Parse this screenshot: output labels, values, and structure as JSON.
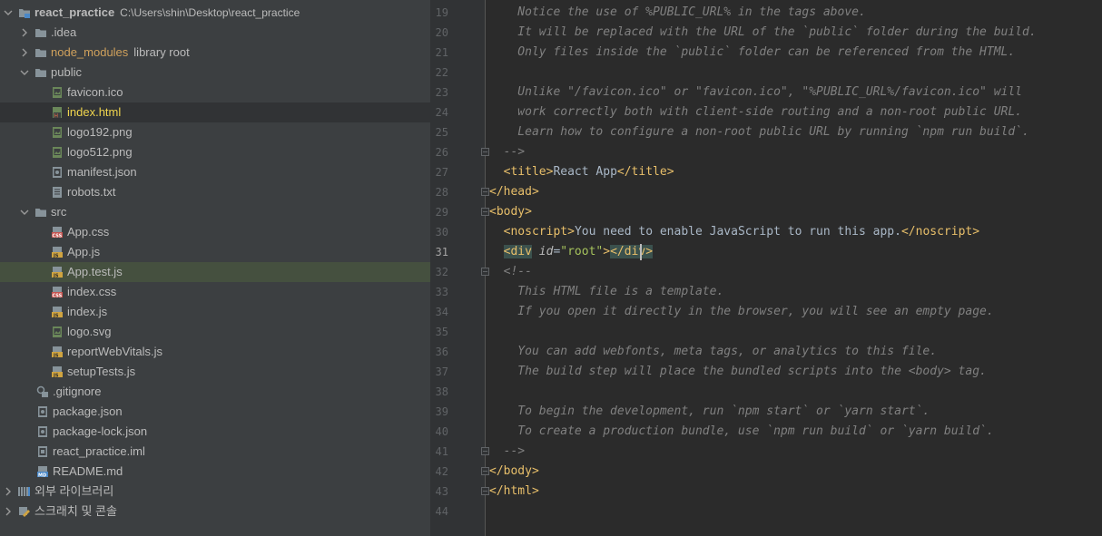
{
  "tree": {
    "root": {
      "name": "react_practice",
      "path": "C:\\Users\\shin\\Desktop\\react_practice"
    },
    "items": [
      {
        "label": ".idea",
        "sub": "",
        "type": "folder",
        "indent": 1,
        "expand": "closed"
      },
      {
        "label": "node_modules",
        "sub": "library root",
        "type": "folder",
        "indent": 1,
        "expand": "closed",
        "color": "#d0a15c"
      },
      {
        "label": "public",
        "sub": "",
        "type": "folder",
        "indent": 1,
        "expand": "open"
      },
      {
        "label": "favicon.ico",
        "sub": "",
        "type": "image",
        "indent": 2
      },
      {
        "label": "index.html",
        "sub": "",
        "type": "html",
        "indent": 2,
        "color": "#f0d54e",
        "selected": true
      },
      {
        "label": "logo192.png",
        "sub": "",
        "type": "image",
        "indent": 2
      },
      {
        "label": "logo512.png",
        "sub": "",
        "type": "image",
        "indent": 2
      },
      {
        "label": "manifest.json",
        "sub": "",
        "type": "json",
        "indent": 2
      },
      {
        "label": "robots.txt",
        "sub": "",
        "type": "text",
        "indent": 2
      },
      {
        "label": "src",
        "sub": "",
        "type": "folder",
        "indent": 1,
        "expand": "open"
      },
      {
        "label": "App.css",
        "sub": "",
        "type": "css",
        "indent": 2
      },
      {
        "label": "App.js",
        "sub": "",
        "type": "js",
        "indent": 2
      },
      {
        "label": "App.test.js",
        "sub": "",
        "type": "js",
        "indent": 2,
        "highlight": true
      },
      {
        "label": "index.css",
        "sub": "",
        "type": "css",
        "indent": 2
      },
      {
        "label": "index.js",
        "sub": "",
        "type": "js",
        "indent": 2
      },
      {
        "label": "logo.svg",
        "sub": "",
        "type": "image",
        "indent": 2
      },
      {
        "label": "reportWebVitals.js",
        "sub": "",
        "type": "js",
        "indent": 2
      },
      {
        "label": "setupTests.js",
        "sub": "",
        "type": "js",
        "indent": 2
      },
      {
        "label": ".gitignore",
        "sub": "",
        "type": "git",
        "indent": 1
      },
      {
        "label": "package.json",
        "sub": "",
        "type": "json",
        "indent": 1
      },
      {
        "label": "package-lock.json",
        "sub": "",
        "type": "json",
        "indent": 1
      },
      {
        "label": "react_practice.iml",
        "sub": "",
        "type": "iml",
        "indent": 1
      },
      {
        "label": "README.md",
        "sub": "",
        "type": "md",
        "indent": 1
      },
      {
        "label": "외부 라이브러리",
        "sub": "",
        "type": "library",
        "indent": 0,
        "expand": "closed"
      },
      {
        "label": "스크래치 및 콘솔",
        "sub": "",
        "type": "scratch",
        "indent": 0,
        "expand": "closed"
      }
    ]
  },
  "editor": {
    "current_line": 31,
    "lines": [
      {
        "n": "19",
        "html": "<span class='comment'>    Notice the use of %PUBLIC_URL% in the tags above.</span>"
      },
      {
        "n": "20",
        "html": "<span class='comment'>    It will be replaced with the URL of the `public` folder during the build.</span>"
      },
      {
        "n": "21",
        "html": "<span class='comment'>    Only files inside the `public` folder can be referenced from the HTML.</span>"
      },
      {
        "n": "22",
        "html": ""
      },
      {
        "n": "23",
        "html": "<span class='comment'>    Unlike \"/favicon.ico\" or \"favicon.ico\", \"%PUBLIC_URL%/favicon.ico\" will</span>"
      },
      {
        "n": "24",
        "html": "<span class='comment'>    work correctly both with client-side routing and a non-root public URL.</span>"
      },
      {
        "n": "25",
        "html": "<span class='comment'>    Learn how to configure a non-root public URL by running `npm run build`.</span>"
      },
      {
        "n": "26",
        "html": "<span class='comment'>  --></span>"
      },
      {
        "n": "27",
        "html": "  <span class='tag'>&lt;title&gt;</span><span class='text'>React App</span><span class='tag'>&lt;/title&gt;</span>"
      },
      {
        "n": "28",
        "html": "<span class='tag'>&lt;/head&gt;</span>"
      },
      {
        "n": "29",
        "html": "<span class='tag'>&lt;body&gt;</span>"
      },
      {
        "n": "30",
        "html": "  <span class='tag'>&lt;noscript&gt;</span><span class='text'>You need to enable JavaScript to run this app.</span><span class='tag'>&lt;/noscript&gt;</span>"
      },
      {
        "n": "31",
        "html": "  <span class='tag paired'>&lt;div</span> <span class='attr'>id</span><span class='text'>=</span><span class='attrv'>\"root\"</span><span class='tag'>&gt;</span><span class='tag paired'>&lt;/div&gt;</span>"
      },
      {
        "n": "32",
        "html": "<span class='comment'>  &lt;!--</span>"
      },
      {
        "n": "33",
        "html": "<span class='comment'>    This HTML file is a template.</span>"
      },
      {
        "n": "34",
        "html": "<span class='comment'>    If you open it directly in the browser, you will see an empty page.</span>"
      },
      {
        "n": "35",
        "html": ""
      },
      {
        "n": "36",
        "html": "<span class='comment'>    You can add webfonts, meta tags, or analytics to this file.</span>"
      },
      {
        "n": "37",
        "html": "<span class='comment'>    The build step will place the bundled scripts into the &lt;body&gt; tag.</span>"
      },
      {
        "n": "38",
        "html": ""
      },
      {
        "n": "39",
        "html": "<span class='comment'>    To begin the development, run `npm start` or `yarn start`.</span>"
      },
      {
        "n": "40",
        "html": "<span class='comment'>    To create a production bundle, use `npm run build` or `yarn build`.</span>"
      },
      {
        "n": "41",
        "html": "<span class='comment'>  --></span>"
      },
      {
        "n": "42",
        "html": "<span class='tag'>&lt;/body&gt;</span>"
      },
      {
        "n": "43",
        "html": "<span class='tag'>&lt;/html&gt;</span>"
      },
      {
        "n": "44",
        "html": ""
      }
    ]
  }
}
